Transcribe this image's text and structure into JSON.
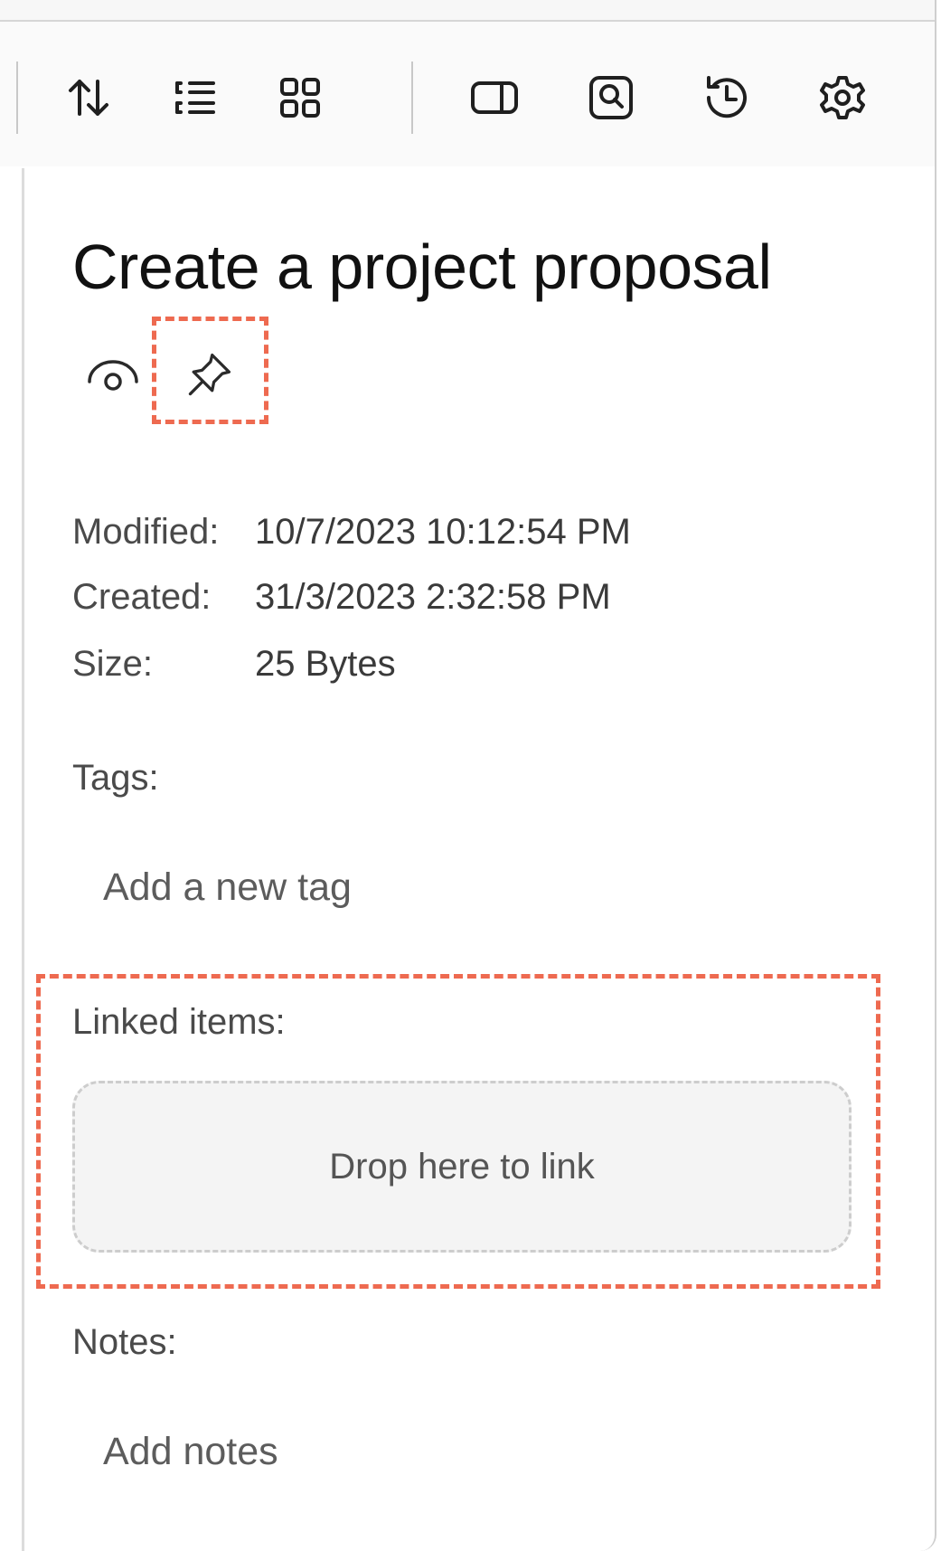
{
  "toolbar": {
    "buttons": [
      {
        "name": "sort-icon",
        "label": "Sort"
      },
      {
        "name": "list-view-icon",
        "label": "List view"
      },
      {
        "name": "grid-view-icon",
        "label": "Grid view"
      },
      {
        "name": "toggle-pane-icon",
        "label": "Toggle details pane"
      },
      {
        "name": "preview-search-icon",
        "label": "Preview"
      },
      {
        "name": "history-icon",
        "label": "History"
      },
      {
        "name": "settings-icon",
        "label": "Settings"
      }
    ]
  },
  "details": {
    "title": "Create a project proposal",
    "actions": [
      {
        "name": "eye-icon"
      },
      {
        "name": "pin-icon"
      }
    ],
    "meta": {
      "modified_label": "Modified:",
      "modified_value": "10/7/2023 10:12:54 PM",
      "created_label": "Created:",
      "created_value": "31/3/2023 2:32:58 PM",
      "size_label": "Size:",
      "size_value": "25 Bytes"
    },
    "tags": {
      "label": "Tags:",
      "placeholder": "Add a new tag"
    },
    "linked": {
      "label": "Linked items:",
      "drop_text": "Drop here to link"
    },
    "notes": {
      "label": "Notes:",
      "placeholder": "Add notes"
    }
  },
  "colors": {
    "highlight": "#ee6a50",
    "drop_zone_bg": "#f4f4f4"
  }
}
